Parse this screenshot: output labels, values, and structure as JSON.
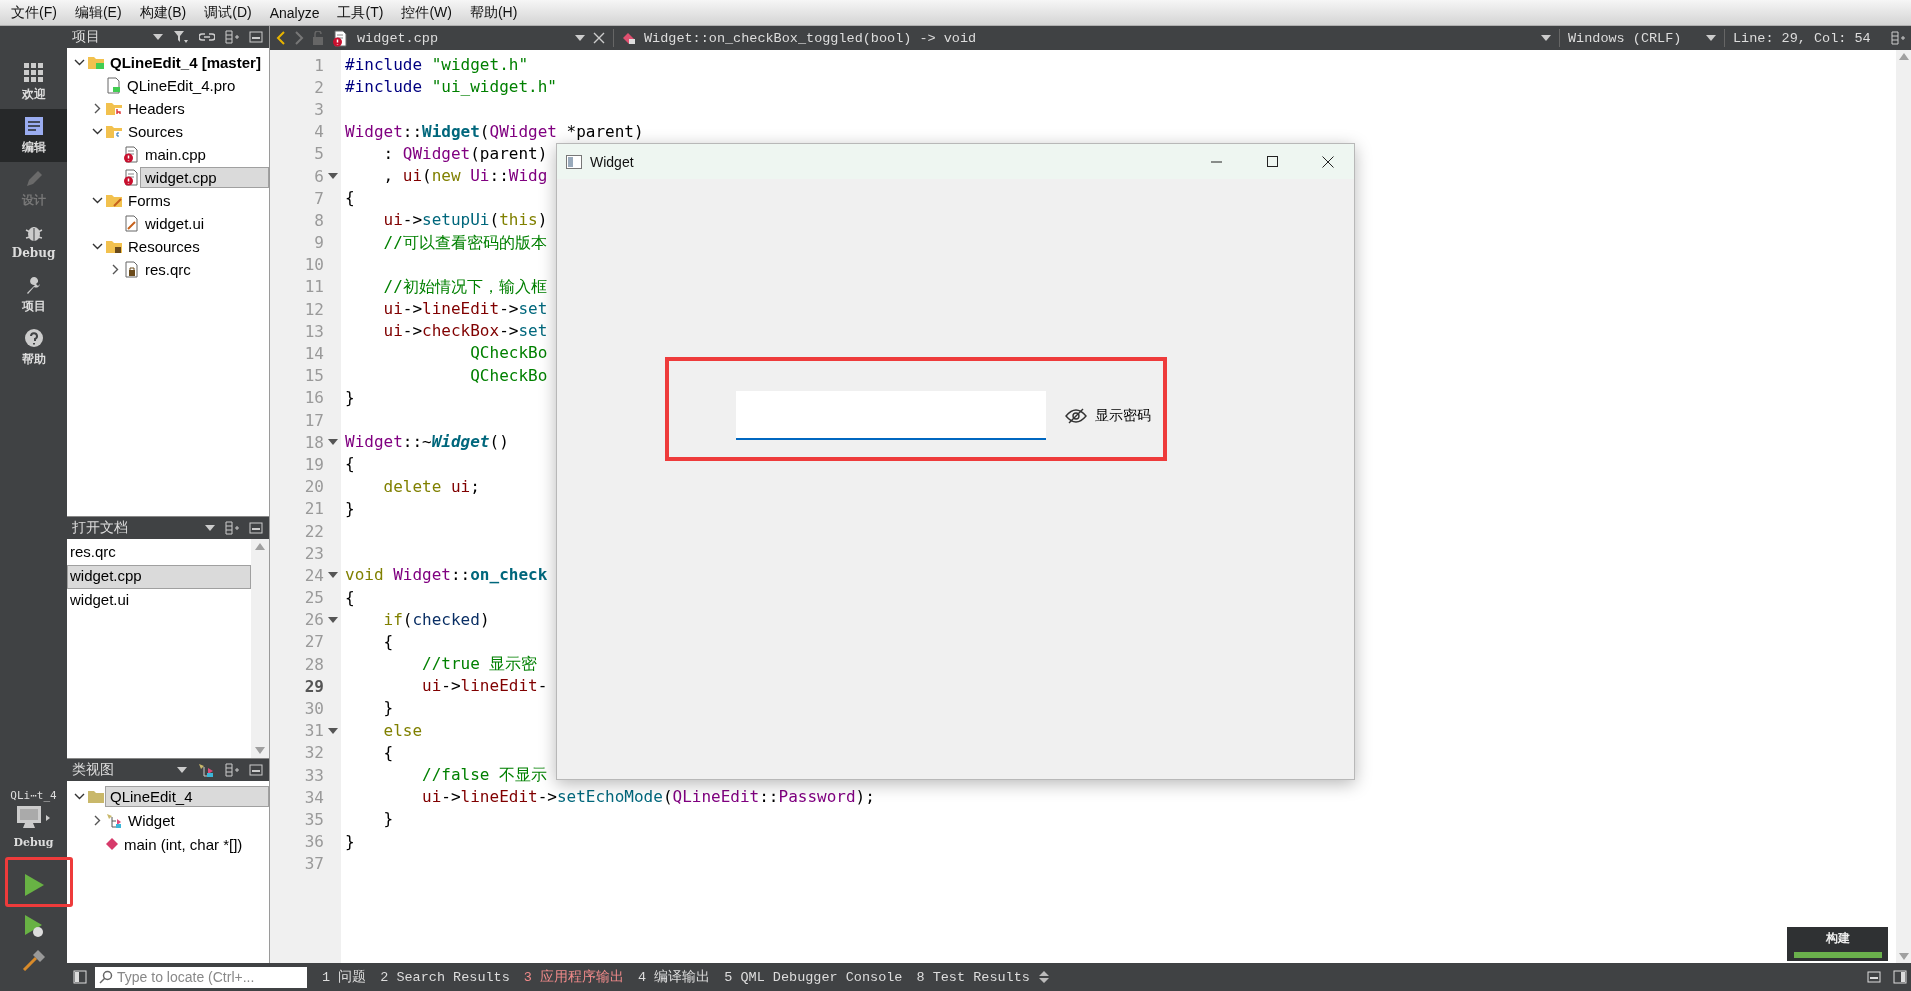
{
  "menu": [
    "文件(F)",
    "编辑(E)",
    "构建(B)",
    "调试(D)",
    "Analyze",
    "工具(T)",
    "控件(W)",
    "帮助(H)"
  ],
  "mode_bar": {
    "modes": [
      {
        "label": "欢迎",
        "kind": "welcome",
        "selected": false,
        "disabled": false
      },
      {
        "label": "编辑",
        "kind": "edit",
        "selected": true,
        "disabled": false
      },
      {
        "label": "设计",
        "kind": "design",
        "selected": false,
        "disabled": true
      },
      {
        "label": "Debug",
        "kind": "debug",
        "selected": false,
        "disabled": false
      },
      {
        "label": "项目",
        "kind": "projects",
        "selected": false,
        "disabled": false
      },
      {
        "label": "帮助",
        "kind": "help",
        "selected": false,
        "disabled": false
      }
    ],
    "target": {
      "project": "QLi⋯t_4",
      "config": "Debug"
    },
    "run_highlighted": true
  },
  "projects_pane": {
    "title": "项目",
    "tree": [
      {
        "label": "QLineEdit_4 [master]",
        "kind": "project",
        "expanded": true,
        "selected": false,
        "children": [
          {
            "label": "QLineEdit_4.pro",
            "kind": "pro",
            "selected": false
          },
          {
            "label": "Headers",
            "kind": "headers",
            "expanded": false,
            "selected": false
          },
          {
            "label": "Sources",
            "kind": "sources",
            "expanded": true,
            "selected": false,
            "children": [
              {
                "label": "main.cpp",
                "kind": "cpp",
                "selected": false
              },
              {
                "label": "widget.cpp",
                "kind": "cpp",
                "selected": true
              }
            ]
          },
          {
            "label": "Forms",
            "kind": "forms",
            "expanded": true,
            "selected": false,
            "children": [
              {
                "label": "widget.ui",
                "kind": "ui",
                "selected": false
              }
            ]
          },
          {
            "label": "Resources",
            "kind": "resources",
            "expanded": true,
            "selected": false,
            "children": [
              {
                "label": "res.qrc",
                "kind": "qrc",
                "expanded": false,
                "selected": false
              }
            ]
          }
        ]
      }
    ]
  },
  "open_documents": {
    "title": "打开文档",
    "items": [
      {
        "label": "res.qrc",
        "selected": false
      },
      {
        "label": "widget.cpp",
        "selected": true
      },
      {
        "label": "widget.ui",
        "selected": false
      }
    ]
  },
  "class_view": {
    "title": "类视图",
    "tree": [
      {
        "label": "QLineEdit_4",
        "kind": "namespace",
        "expanded": true,
        "selected": true,
        "children": [
          {
            "label": "Widget",
            "kind": "class",
            "expanded": false,
            "selected": false
          },
          {
            "label": "main (int, char *[])",
            "kind": "function",
            "selected": false
          }
        ]
      }
    ]
  },
  "editor": {
    "file": "widget.cpp",
    "symbol": "Widget::on_checkBox_toggled(bool) -> void",
    "line_ending": "Windows (CRLF)",
    "position": "Line: 29, Col: 54",
    "lines": [
      {
        "n": "1",
        "fold": false,
        "current": false,
        "code": [
          {
            "text": "#include ",
            "kind": "pre"
          },
          {
            "text": "\"widget.h\"",
            "kind": "str"
          }
        ]
      },
      {
        "n": "2",
        "fold": false,
        "current": false,
        "code": [
          {
            "text": "#include ",
            "kind": "pre"
          },
          {
            "text": "\"ui_widget.h\"",
            "kind": "str"
          }
        ]
      },
      {
        "n": "3",
        "fold": false,
        "current": false
      },
      {
        "n": "4",
        "fold": false,
        "current": false,
        "code": [
          {
            "text": "Widget",
            "kind": "cls"
          },
          {
            "text": "::",
            "kind": "p"
          },
          {
            "text": "Widget",
            "kind": "fn"
          },
          {
            "text": "(",
            "kind": "p"
          },
          {
            "text": "QWidget",
            "kind": "cls"
          },
          {
            "text": " *parent)",
            "kind": "p"
          }
        ]
      },
      {
        "n": "5",
        "fold": false,
        "current": false,
        "code": [
          {
            "text": "    : ",
            "kind": "p"
          },
          {
            "text": "QWidget",
            "kind": "cls"
          },
          {
            "text": "(parent)",
            "kind": "p"
          }
        ]
      },
      {
        "n": "6",
        "fold": true,
        "current": false,
        "code": [
          {
            "text": "    , ",
            "kind": "p"
          },
          {
            "text": "ui",
            "kind": "mem"
          },
          {
            "text": "(",
            "kind": "p"
          },
          {
            "text": "new ",
            "kind": "kw"
          },
          {
            "text": "Ui",
            "kind": "cls"
          },
          {
            "text": "::",
            "kind": "p"
          },
          {
            "text": "Widg",
            "kind": "cls"
          }
        ]
      },
      {
        "n": "7",
        "fold": false,
        "current": false,
        "code": [
          {
            "text": "{",
            "kind": "p"
          }
        ]
      },
      {
        "n": "8",
        "fold": false,
        "current": false,
        "code": [
          {
            "text": "    ui",
            "kind": "mem"
          },
          {
            "text": "->",
            "kind": "p"
          },
          {
            "text": "setupUi",
            "kind": "call"
          },
          {
            "text": "(",
            "kind": "p"
          },
          {
            "text": "this",
            "kind": "kw"
          },
          {
            "text": ")",
            "kind": "p"
          }
        ]
      },
      {
        "n": "9",
        "fold": false,
        "current": false,
        "code": [
          {
            "text": "    //可以查看密码的版本",
            "kind": "com"
          }
        ]
      },
      {
        "n": "10",
        "fold": false,
        "current": false
      },
      {
        "n": "11",
        "fold": false,
        "current": false,
        "code": [
          {
            "text": "    //初始情况下，输入框",
            "kind": "com"
          }
        ]
      },
      {
        "n": "12",
        "fold": false,
        "current": false,
        "code": [
          {
            "text": "    ui",
            "kind": "mem"
          },
          {
            "text": "->",
            "kind": "p"
          },
          {
            "text": "lineEdit",
            "kind": "mem"
          },
          {
            "text": "->",
            "kind": "p"
          },
          {
            "text": "set",
            "kind": "call"
          }
        ]
      },
      {
        "n": "13",
        "fold": false,
        "current": false,
        "code": [
          {
            "text": "    ui",
            "kind": "mem"
          },
          {
            "text": "->",
            "kind": "p"
          },
          {
            "text": "checkBox",
            "kind": "mem"
          },
          {
            "text": "->",
            "kind": "p"
          },
          {
            "text": "set",
            "kind": "call"
          }
        ]
      },
      {
        "n": "14",
        "fold": false,
        "current": false,
        "code": [
          {
            "text": "             QCheckBo",
            "kind": "en"
          }
        ]
      },
      {
        "n": "15",
        "fold": false,
        "current": false,
        "code": [
          {
            "text": "             QCheckBo",
            "kind": "en"
          }
        ]
      },
      {
        "n": "16",
        "fold": false,
        "current": false,
        "code": [
          {
            "text": "}",
            "kind": "p"
          }
        ]
      },
      {
        "n": "17",
        "fold": false,
        "current": false
      },
      {
        "n": "18",
        "fold": true,
        "current": false,
        "code": [
          {
            "text": "Widget",
            "kind": "cls"
          },
          {
            "text": "::~",
            "kind": "p"
          },
          {
            "text": "Widget",
            "kind": "fni"
          },
          {
            "text": "()",
            "kind": "p"
          }
        ]
      },
      {
        "n": "19",
        "fold": false,
        "current": false,
        "code": [
          {
            "text": "{",
            "kind": "p"
          }
        ]
      },
      {
        "n": "20",
        "fold": false,
        "current": false,
        "code": [
          {
            "text": "    delete ",
            "kind": "kw"
          },
          {
            "text": "ui",
            "kind": "mem"
          },
          {
            "text": ";",
            "kind": "p"
          }
        ]
      },
      {
        "n": "21",
        "fold": false,
        "current": false,
        "code": [
          {
            "text": "}",
            "kind": "p"
          }
        ]
      },
      {
        "n": "22",
        "fold": false,
        "current": false
      },
      {
        "n": "23",
        "fold": false,
        "current": false
      },
      {
        "n": "24",
        "fold": true,
        "current": false,
        "code": [
          {
            "text": "void ",
            "kind": "kw"
          },
          {
            "text": "Widget",
            "kind": "cls"
          },
          {
            "text": "::",
            "kind": "p"
          },
          {
            "text": "on_check",
            "kind": "fn"
          }
        ]
      },
      {
        "n": "25",
        "fold": false,
        "current": false,
        "code": [
          {
            "text": "{",
            "kind": "p"
          }
        ]
      },
      {
        "n": "26",
        "fold": true,
        "current": false,
        "code": [
          {
            "text": "    if",
            "kind": "kw"
          },
          {
            "text": "(",
            "kind": "p"
          },
          {
            "text": "checked",
            "kind": "par"
          },
          {
            "text": ")",
            "kind": "p"
          }
        ]
      },
      {
        "n": "27",
        "fold": false,
        "current": false,
        "code": [
          {
            "text": "    {",
            "kind": "p"
          }
        ]
      },
      {
        "n": "28",
        "fold": false,
        "current": false,
        "code": [
          {
            "text": "        //true 显示密",
            "kind": "com"
          }
        ]
      },
      {
        "n": "29",
        "fold": false,
        "current": true,
        "code": [
          {
            "text": "        ui",
            "kind": "mem"
          },
          {
            "text": "->",
            "kind": "p"
          },
          {
            "text": "lineEdit",
            "kind": "mem"
          },
          {
            "text": "-",
            "kind": "p"
          }
        ]
      },
      {
        "n": "30",
        "fold": false,
        "current": false,
        "code": [
          {
            "text": "    }",
            "kind": "p"
          }
        ]
      },
      {
        "n": "31",
        "fold": true,
        "current": false,
        "code": [
          {
            "text": "    else",
            "kind": "kw"
          }
        ]
      },
      {
        "n": "32",
        "fold": false,
        "current": false,
        "code": [
          {
            "text": "    {",
            "kind": "p"
          }
        ]
      },
      {
        "n": "33",
        "fold": false,
        "current": false,
        "code": [
          {
            "text": "        //false 不显示",
            "kind": "com"
          }
        ]
      },
      {
        "n": "34",
        "fold": false,
        "current": false,
        "code": [
          {
            "text": "        ui",
            "kind": "mem"
          },
          {
            "text": "->",
            "kind": "p"
          },
          {
            "text": "lineEdit",
            "kind": "mem"
          },
          {
            "text": "->",
            "kind": "p"
          },
          {
            "text": "setEchoMode",
            "kind": "call"
          },
          {
            "text": "(",
            "kind": "p"
          },
          {
            "text": "QLineEdit",
            "kind": "cls"
          },
          {
            "text": "::",
            "kind": "p"
          },
          {
            "text": "Password",
            "kind": "cls"
          },
          {
            "text": ");",
            "kind": "p"
          }
        ]
      },
      {
        "n": "35",
        "fold": false,
        "current": false,
        "code": [
          {
            "text": "    }",
            "kind": "p"
          }
        ]
      },
      {
        "n": "36",
        "fold": false,
        "current": false,
        "code": [
          {
            "text": "}",
            "kind": "p"
          }
        ]
      },
      {
        "n": "37",
        "fold": false,
        "current": false
      }
    ]
  },
  "app_window": {
    "title": "Widget",
    "checkbox": {
      "label": "显示密码",
      "checked": false
    },
    "highlighted": true
  },
  "build_progress": {
    "label": "构建",
    "level": 1
  },
  "output_bar": {
    "locator_placeholder": "Type to locate (Ctrl+...",
    "tabs": [
      {
        "label": "1 问题",
        "attention": false
      },
      {
        "label": "2 Search Results",
        "attention": false
      },
      {
        "label": "3 应用程序输出",
        "attention": true
      },
      {
        "label": "4 编译输出",
        "attention": false
      },
      {
        "label": "5 QML Debugger Console",
        "attention": false
      },
      {
        "label": "8 Test Results",
        "attention": false
      }
    ]
  }
}
